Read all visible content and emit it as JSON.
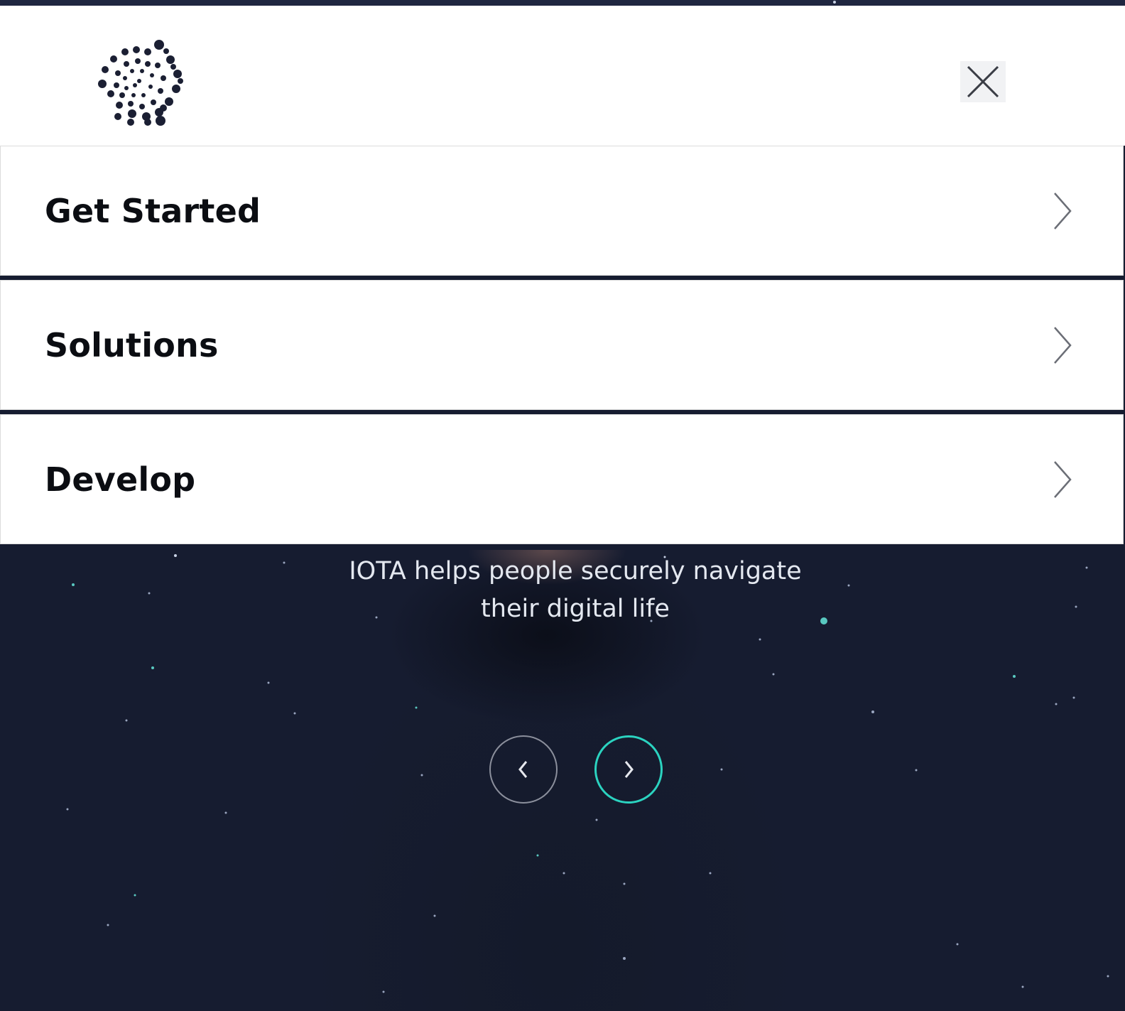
{
  "header": {
    "logo_icon": "iota-logo-icon",
    "close_icon": "close-icon"
  },
  "menu": {
    "items": [
      {
        "label": "Get Started",
        "icon": "chevron-right-icon"
      },
      {
        "label": "Solutions",
        "icon": "chevron-right-icon"
      },
      {
        "label": "Develop",
        "icon": "chevron-right-icon"
      }
    ]
  },
  "hero": {
    "tagline_line1": "IOTA helps people securely navigate",
    "tagline_line2": "their digital life",
    "prev_icon": "chevron-left-icon",
    "next_icon": "chevron-right-icon"
  },
  "colors": {
    "dark_navy": "#161c30",
    "accent_teal": "#2bd3c0",
    "logo": "#1b1f33"
  }
}
